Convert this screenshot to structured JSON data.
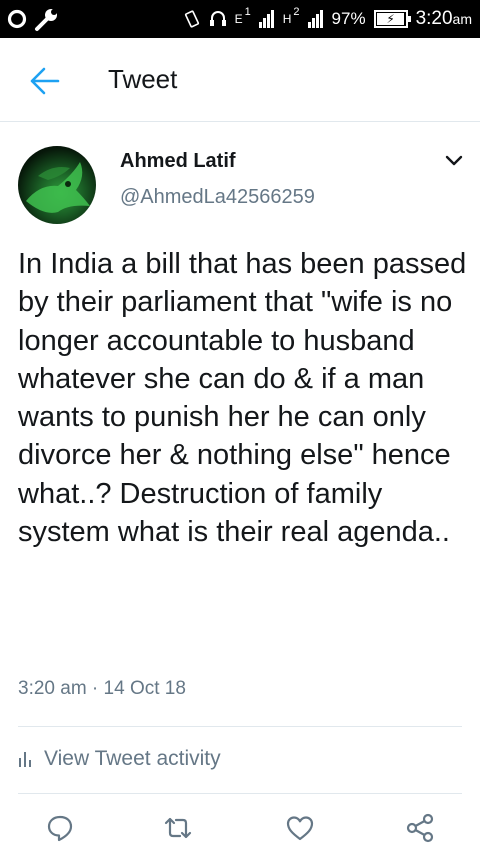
{
  "status_bar": {
    "battery_percent": "97%",
    "battery_level": 0.97,
    "time": "3:20",
    "ampm": "am",
    "network_e": "E",
    "network_h": "H",
    "sim1": "1",
    "sim2": "2"
  },
  "header": {
    "title": "Tweet"
  },
  "tweet": {
    "display_name": "Ahmed Latif",
    "handle": "@AhmedLa42566259",
    "text": "In India a bill that has been passed by their parliament that \"wife is no longer accountable to husband whatever she can do & if a man wants to punish her he can only divorce her & nothing else\" hence what..? Destruction of family system what is their real agenda..",
    "timestamp": "3:20 am · 14 Oct 18",
    "activity_label": "View Tweet activity"
  },
  "colors": {
    "accent": "#1da1f2",
    "secondary_text": "#657786",
    "divider": "#e1e8ed",
    "icon": "#657786"
  }
}
